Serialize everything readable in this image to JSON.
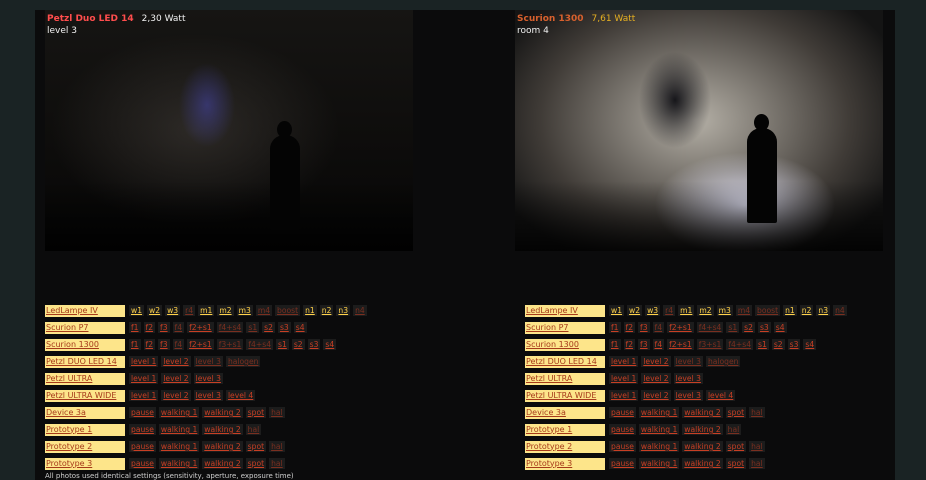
{
  "left_panel": {
    "lamp": "Petzl Duo LED 14",
    "watt": "2,30 Watt",
    "setting": "level 3",
    "rows": [
      {
        "label": "LedLampe IV",
        "options": [
          [
            "w1",
            "y"
          ],
          [
            "w2",
            "y"
          ],
          [
            "w3",
            "y"
          ],
          [
            "r4",
            "d"
          ],
          [
            "m1",
            "y"
          ],
          [
            "m2",
            "y"
          ],
          [
            "m3",
            "y"
          ],
          [
            "m4",
            "d"
          ],
          [
            "boost",
            "d"
          ],
          [
            "n1",
            "y"
          ],
          [
            "n2",
            "y"
          ],
          [
            "n3",
            "y"
          ],
          [
            "n4",
            "d"
          ]
        ]
      },
      {
        "label": "Scurion P7",
        "options": [
          [
            "f1",
            "r"
          ],
          [
            "f2",
            "r"
          ],
          [
            "f3",
            "r"
          ],
          [
            "f4",
            "d"
          ],
          [
            "f2+s1",
            "r"
          ],
          [
            "f4+s4",
            "d"
          ],
          [
            "s1",
            "d"
          ],
          [
            "s2",
            "r"
          ],
          [
            "s3",
            "r"
          ],
          [
            "s4",
            "r"
          ]
        ]
      },
      {
        "label": "Scurion 1300",
        "options": [
          [
            "f1",
            "r"
          ],
          [
            "f2",
            "r"
          ],
          [
            "f3",
            "r"
          ],
          [
            "f4",
            "d"
          ],
          [
            "f2+s1",
            "r"
          ],
          [
            "f3+s1",
            "d"
          ],
          [
            "f4+s4",
            "d"
          ],
          [
            "s1",
            "r"
          ],
          [
            "s2",
            "r"
          ],
          [
            "s3",
            "r"
          ],
          [
            "s4",
            "r"
          ]
        ]
      },
      {
        "label": "Petzl DUO LED 14",
        "options": [
          [
            "level 1",
            "r"
          ],
          [
            "level 2",
            "r"
          ],
          [
            "level 3",
            "d"
          ],
          [
            "halogen",
            "d"
          ]
        ]
      },
      {
        "label": "Petzl ULTRA",
        "options": [
          [
            "level 1",
            "r"
          ],
          [
            "level 2",
            "r"
          ],
          [
            "level 3",
            "r"
          ]
        ]
      },
      {
        "label": "Petzl ULTRA WIDE",
        "options": [
          [
            "level 1",
            "r"
          ],
          [
            "level 2",
            "r"
          ],
          [
            "level 3",
            "r"
          ],
          [
            "level 4",
            "r"
          ]
        ]
      },
      {
        "label": "Device 3a",
        "options": [
          [
            "pause",
            "r"
          ],
          [
            "walking 1",
            "r"
          ],
          [
            "walking 2",
            "r"
          ],
          [
            "spot",
            "r"
          ],
          [
            "hal",
            "d"
          ]
        ]
      },
      {
        "label": "Prototype 1",
        "options": [
          [
            "pause",
            "r"
          ],
          [
            "walking 1",
            "r"
          ],
          [
            "walking 2",
            "r"
          ],
          [
            "hal",
            "d"
          ]
        ]
      },
      {
        "label": "Prototype 2",
        "options": [
          [
            "pause",
            "r"
          ],
          [
            "walking 1",
            "r"
          ],
          [
            "walking 2",
            "r"
          ],
          [
            "spot",
            "r"
          ],
          [
            "hal",
            "d"
          ]
        ]
      },
      {
        "label": "Prototype 3",
        "options": [
          [
            "pause",
            "r"
          ],
          [
            "walking 1",
            "r"
          ],
          [
            "walking 2",
            "r"
          ],
          [
            "spot",
            "r"
          ],
          [
            "hal",
            "d"
          ]
        ]
      }
    ]
  },
  "right_panel": {
    "lamp": "Scurion 1300",
    "watt": "7,61 Watt",
    "setting": "room 4",
    "rows": [
      {
        "label": "LedLampe IV",
        "options": [
          [
            "w1",
            "y"
          ],
          [
            "w2",
            "y"
          ],
          [
            "w3",
            "y"
          ],
          [
            "r4",
            "d"
          ],
          [
            "m1",
            "y"
          ],
          [
            "m2",
            "y"
          ],
          [
            "m3",
            "y"
          ],
          [
            "m4",
            "d"
          ],
          [
            "boost",
            "d"
          ],
          [
            "n1",
            "y"
          ],
          [
            "n2",
            "y"
          ],
          [
            "n3",
            "y"
          ],
          [
            "n4",
            "d"
          ]
        ]
      },
      {
        "label": "Scurion P7",
        "options": [
          [
            "f1",
            "r"
          ],
          [
            "f2",
            "r"
          ],
          [
            "f3",
            "r"
          ],
          [
            "f4",
            "d"
          ],
          [
            "f2+s1",
            "r"
          ],
          [
            "f4+s4",
            "d"
          ],
          [
            "s1",
            "d"
          ],
          [
            "s2",
            "r"
          ],
          [
            "s3",
            "r"
          ],
          [
            "s4",
            "r"
          ]
        ]
      },
      {
        "label": "Scurion 1300",
        "options": [
          [
            "f1",
            "r"
          ],
          [
            "f2",
            "r"
          ],
          [
            "f3",
            "r"
          ],
          [
            "f4",
            "r"
          ],
          [
            "f2+s1",
            "r"
          ],
          [
            "f3+s1",
            "d"
          ],
          [
            "f4+s4",
            "d"
          ],
          [
            "s1",
            "r"
          ],
          [
            "s2",
            "r"
          ],
          [
            "s3",
            "r"
          ],
          [
            "s4",
            "r"
          ]
        ]
      },
      {
        "label": "Petzl DUO LED 14",
        "options": [
          [
            "level 1",
            "r"
          ],
          [
            "level 2",
            "r"
          ],
          [
            "level 3",
            "d"
          ],
          [
            "halogen",
            "d"
          ]
        ]
      },
      {
        "label": "Petzl ULTRA",
        "options": [
          [
            "level 1",
            "r"
          ],
          [
            "level 2",
            "r"
          ],
          [
            "level 3",
            "r"
          ]
        ]
      },
      {
        "label": "Petzl ULTRA WIDE",
        "options": [
          [
            "level 1",
            "r"
          ],
          [
            "level 2",
            "r"
          ],
          [
            "level 3",
            "r"
          ],
          [
            "level 4",
            "r"
          ]
        ]
      },
      {
        "label": "Device 3a",
        "options": [
          [
            "pause",
            "r"
          ],
          [
            "walking 1",
            "r"
          ],
          [
            "walking 2",
            "r"
          ],
          [
            "spot",
            "r"
          ],
          [
            "hal",
            "d"
          ]
        ]
      },
      {
        "label": "Prototype 1",
        "options": [
          [
            "pause",
            "r"
          ],
          [
            "walking 1",
            "r"
          ],
          [
            "walking 2",
            "r"
          ],
          [
            "hal",
            "d"
          ]
        ]
      },
      {
        "label": "Prototype 2",
        "options": [
          [
            "pause",
            "r"
          ],
          [
            "walking 1",
            "r"
          ],
          [
            "walking 2",
            "r"
          ],
          [
            "spot",
            "r"
          ],
          [
            "hal",
            "d"
          ]
        ]
      },
      {
        "label": "Prototype 3",
        "options": [
          [
            "pause",
            "r"
          ],
          [
            "walking 1",
            "r"
          ],
          [
            "walking 2",
            "r"
          ],
          [
            "spot",
            "r"
          ],
          [
            "hal",
            "d"
          ]
        ]
      }
    ]
  },
  "footnote": "All photos used identical settings (sensitivity, aperture, exposure time)"
}
